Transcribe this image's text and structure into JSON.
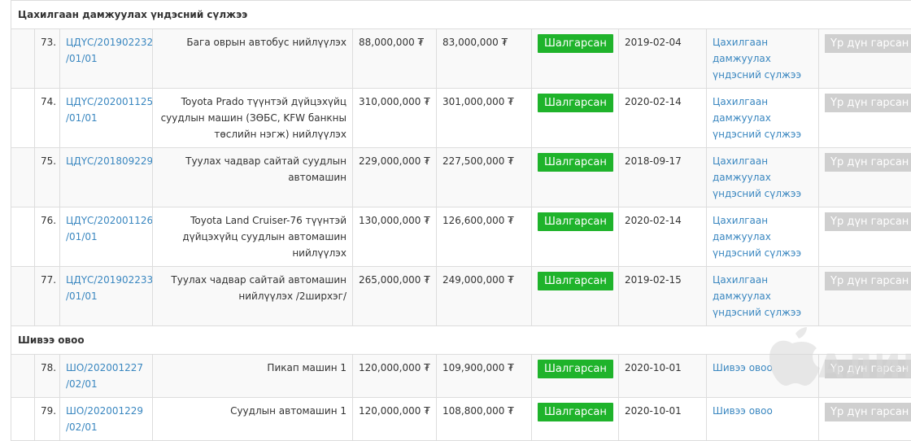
{
  "groups": [
    {
      "title": "Цахилгаан дамжуулах үндэсний сүлжээ",
      "rows": [
        {
          "num": "73.",
          "code": "ЦДҮС/201902232 /01/01",
          "name": "Бага оврын автобус нийлүүлэх",
          "budget": "88,000,000 ₮",
          "contract": "83,000,000 ₮",
          "status": "Шалгарсан",
          "date": "2019-02-04",
          "org": "Цахилгаан дамжуулах үндэсний сүлжээ",
          "action": "Үр дүн гарсан"
        },
        {
          "num": "74.",
          "code": "ЦДҮС/202001125 /01/01",
          "name": "Toyota Prado түүнтэй дүйцэхүйц суудлын машин (ЗӨБС, KFW банкны төслийн нэгж) нийлүүлэх",
          "budget": "310,000,000 ₮",
          "contract": "301,000,000 ₮",
          "status": "Шалгарсан",
          "date": "2020-02-14",
          "org": "Цахилгаан дамжуулах үндэсний сүлжээ",
          "action": "Үр дүн гарсан"
        },
        {
          "num": "75.",
          "code": "ЦДҮС/201809229",
          "name": "Туулах чадвар сайтай суудлын автомашин",
          "budget": "229,000,000 ₮",
          "contract": "227,500,000 ₮",
          "status": "Шалгарсан",
          "date": "2018-09-17",
          "org": "Цахилгаан дамжуулах үндэсний сүлжээ",
          "action": "Үр дүн гарсан"
        },
        {
          "num": "76.",
          "code": "ЦДҮС/202001126 /01/01",
          "name": "Toyota Land Cruiser-76 түүнтэй дүйцэхүйц суудлын автомашин нийлүүлэх",
          "budget": "130,000,000 ₮",
          "contract": "126,600,000 ₮",
          "status": "Шалгарсан",
          "date": "2020-02-14",
          "org": "Цахилгаан дамжуулах үндэсний сүлжээ",
          "action": "Үр дүн гарсан"
        },
        {
          "num": "77.",
          "code": "ЦДҮС/201902233 /01/01",
          "name": "Туулах чадвар сайтай автомашин нийлүүлэх /2ширхэг/",
          "budget": "265,000,000 ₮",
          "contract": "249,000,000 ₮",
          "status": "Шалгарсан",
          "date": "2019-02-15",
          "org": "Цахилгаан дамжуулах үндэсний сүлжээ",
          "action": "Үр дүн гарсан"
        }
      ]
    },
    {
      "title": "Шивээ овоо",
      "rows": [
        {
          "num": "78.",
          "code": "ШО/202001227 /02/01",
          "name": "Пикап машин 1",
          "budget": "120,000,000 ₮",
          "contract": "109,900,000 ₮",
          "status": "Шалгарсан",
          "date": "2020-10-01",
          "org": "Шивээ овоо",
          "action": "Үр дүн гарсан"
        },
        {
          "num": "79.",
          "code": "ШО/202001229 /02/01",
          "name": "Суудлын автомашин 1",
          "budget": "120,000,000 ₮",
          "contract": "108,800,000 ₮",
          "status": "Шалгарсан",
          "date": "2020-10-01",
          "org": "Шивээ овоо",
          "action": "Үр дүн гарсан"
        }
      ]
    }
  ],
  "watermark": "АЛИМ",
  "colors": {
    "status_green": "#1fb32b",
    "link_blue": "#3a87c0",
    "disabled_gray": "#cfcfcf"
  }
}
